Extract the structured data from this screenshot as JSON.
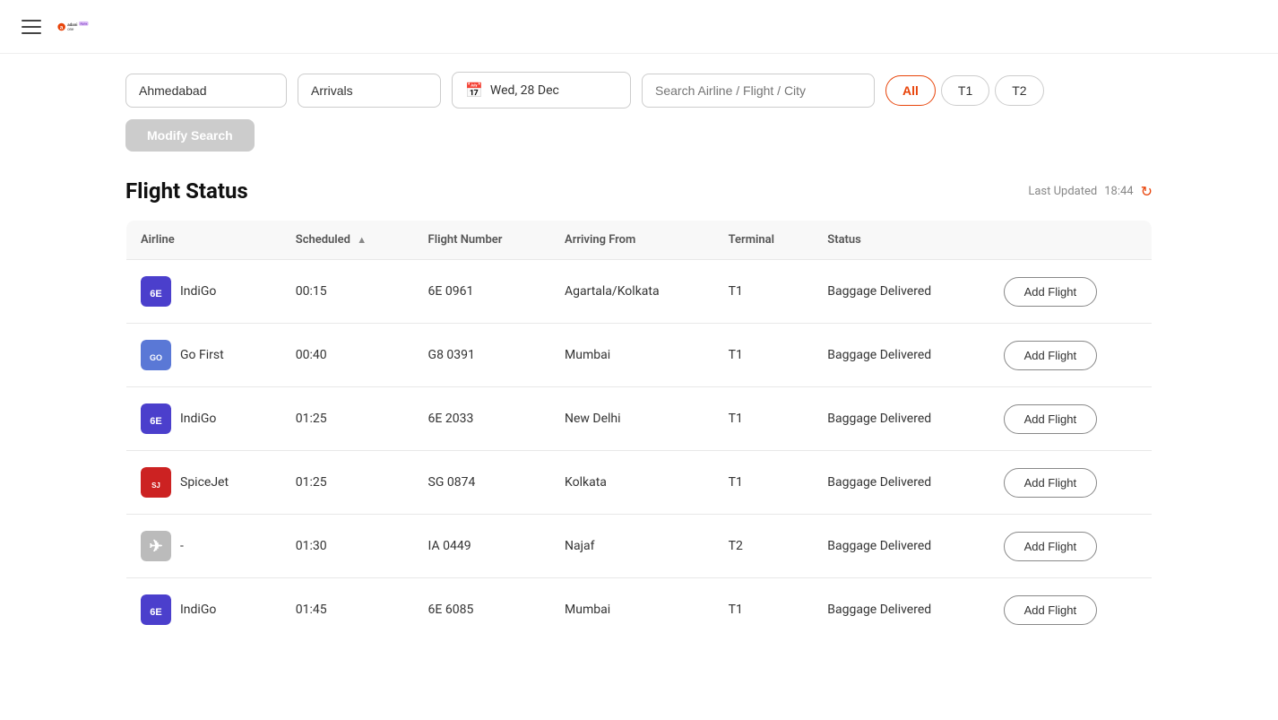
{
  "navbar": {
    "logo_alt": "Adani One Alpha"
  },
  "search": {
    "city_value": "Ahmedabad",
    "type_value": "Arrivals",
    "date_value": "Wed, 28 Dec",
    "date_placeholder": "Wed, 28 Dec",
    "airline_placeholder": "Search Airline / Flight / City",
    "filter_all": "All",
    "filter_t1": "T1",
    "filter_t2": "T2",
    "modify_label": "Modify Search"
  },
  "flight_status": {
    "title": "Flight Status",
    "last_updated_label": "Last Updated",
    "last_updated_time": "18:44",
    "columns": {
      "airline": "Airline",
      "scheduled": "Scheduled",
      "flight_number": "Flight Number",
      "arriving_from": "Arriving From",
      "terminal": "Terminal",
      "status": "Status"
    },
    "flights": [
      {
        "airline_name": "IndiGo",
        "airline_key": "indigo",
        "scheduled": "00:15",
        "flight_number": "6E 0961",
        "arriving_from": "Agartala/Kolkata",
        "terminal": "T1",
        "status": "Baggage Delivered",
        "add_label": "Add Flight"
      },
      {
        "airline_name": "Go First",
        "airline_key": "gofirst",
        "scheduled": "00:40",
        "flight_number": "G8 0391",
        "arriving_from": "Mumbai",
        "terminal": "T1",
        "status": "Baggage Delivered",
        "add_label": "Add Flight"
      },
      {
        "airline_name": "IndiGo",
        "airline_key": "indigo",
        "scheduled": "01:25",
        "flight_number": "6E 2033",
        "arriving_from": "New Delhi",
        "terminal": "T1",
        "status": "Baggage Delivered",
        "add_label": "Add Flight"
      },
      {
        "airline_name": "SpiceJet",
        "airline_key": "spicejet",
        "scheduled": "01:25",
        "flight_number": "SG 0874",
        "arriving_from": "Kolkata",
        "terminal": "T1",
        "status": "Baggage Delivered",
        "add_label": "Add Flight"
      },
      {
        "airline_name": "-",
        "airline_key": "unknown",
        "scheduled": "01:30",
        "flight_number": "IA 0449",
        "arriving_from": "Najaf",
        "terminal": "T2",
        "status": "Baggage Delivered",
        "add_label": "Add Flight"
      },
      {
        "airline_name": "IndiGo",
        "airline_key": "indigo",
        "scheduled": "01:45",
        "flight_number": "6E 6085",
        "arriving_from": "Mumbai",
        "terminal": "T1",
        "status": "Baggage Delivered",
        "add_label": "Add Flight"
      }
    ]
  }
}
